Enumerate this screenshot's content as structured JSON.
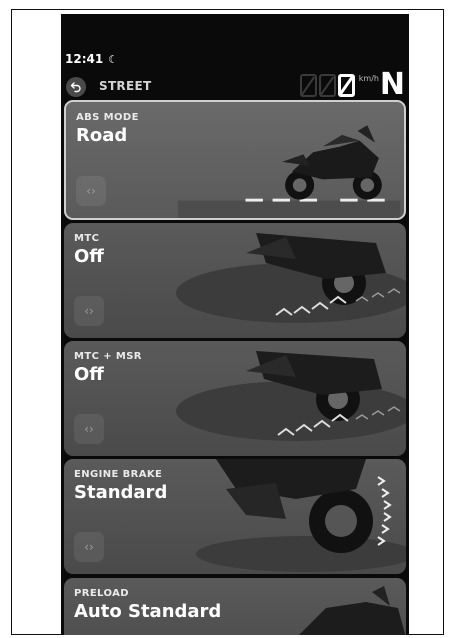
{
  "status_bar": {
    "time": "12:41",
    "moon_icon": "☾"
  },
  "header": {
    "ride_mode": "STREET",
    "speed_unit": "km/h",
    "gear": "N"
  },
  "cards": [
    {
      "title": "ABS MODE",
      "value": "Road",
      "toggle_icon": "‹›",
      "selected": true
    },
    {
      "title": "MTC",
      "value": "Off",
      "toggle_icon": "‹›",
      "selected": false
    },
    {
      "title": "MTC + MSR",
      "value": "Off",
      "toggle_icon": "‹›",
      "selected": false
    },
    {
      "title": "ENGINE BRAKE",
      "value": "Standard",
      "toggle_icon": "‹›",
      "selected": false
    },
    {
      "title": "PRELOAD",
      "value": "Auto Standard",
      "selected": false
    }
  ]
}
